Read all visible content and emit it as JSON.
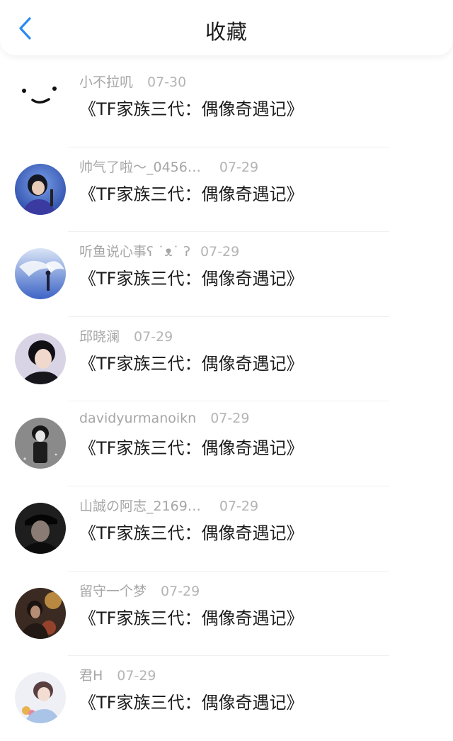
{
  "header": {
    "title": "收藏",
    "back_icon": "chevron-left-icon",
    "accent_color": "#2b8af0"
  },
  "items": [
    {
      "author": "小不拉叽",
      "date": "07-30",
      "content": "《TF家族三代：偶像奇遇记》",
      "avatar": "emoticon-face"
    },
    {
      "author": "帅气了啦～_0456…",
      "date": "07-29",
      "content": "《TF家族三代：偶像奇遇记》",
      "avatar": "photo"
    },
    {
      "author": "听鱼说心事ʕ ˙ᴥ˙ ʔ",
      "date": "07-29",
      "content": "《TF家族三代：偶像奇遇记》",
      "avatar": "photo"
    },
    {
      "author": "邱晓澜",
      "date": "07-29",
      "content": "《TF家族三代：偶像奇遇记》",
      "avatar": "photo"
    },
    {
      "author": "davidyurmanoikn",
      "date": "07-29",
      "content": "《TF家族三代：偶像奇遇记》",
      "avatar": "photo"
    },
    {
      "author": "山誠の阿志_2169…",
      "date": "07-29",
      "content": "《TF家族三代：偶像奇遇记》",
      "avatar": "photo"
    },
    {
      "author": "留守一个梦",
      "date": "07-29",
      "content": "《TF家族三代：偶像奇遇记》",
      "avatar": "photo"
    },
    {
      "author": "君H",
      "date": "07-29",
      "content": "《TF家族三代：偶像奇遇记》",
      "avatar": "photo"
    }
  ]
}
